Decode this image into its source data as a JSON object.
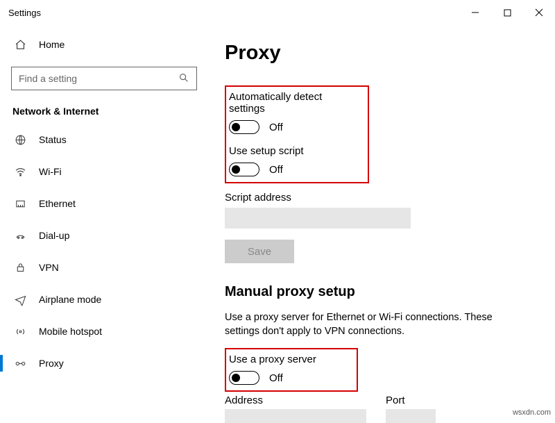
{
  "titlebar": {
    "title": "Settings"
  },
  "sidebar": {
    "home": "Home",
    "search_placeholder": "Find a setting",
    "group": "Network & Internet",
    "items": [
      {
        "label": "Status"
      },
      {
        "label": "Wi-Fi"
      },
      {
        "label": "Ethernet"
      },
      {
        "label": "Dial-up"
      },
      {
        "label": "VPN"
      },
      {
        "label": "Airplane mode"
      },
      {
        "label": "Mobile hotspot"
      },
      {
        "label": "Proxy"
      }
    ]
  },
  "page": {
    "title": "Proxy",
    "auto_detect_label": "Automatically detect settings",
    "auto_detect_state": "Off",
    "setup_script_label": "Use setup script",
    "setup_script_state": "Off",
    "script_address_label": "Script address",
    "save": "Save",
    "manual_heading": "Manual proxy setup",
    "manual_desc": "Use a proxy server for Ethernet or Wi-Fi connections. These settings don't apply to VPN connections.",
    "use_proxy_label": "Use a proxy server",
    "use_proxy_state": "Off",
    "address_label": "Address",
    "port_label": "Port"
  },
  "watermark": "wsxdn.com"
}
